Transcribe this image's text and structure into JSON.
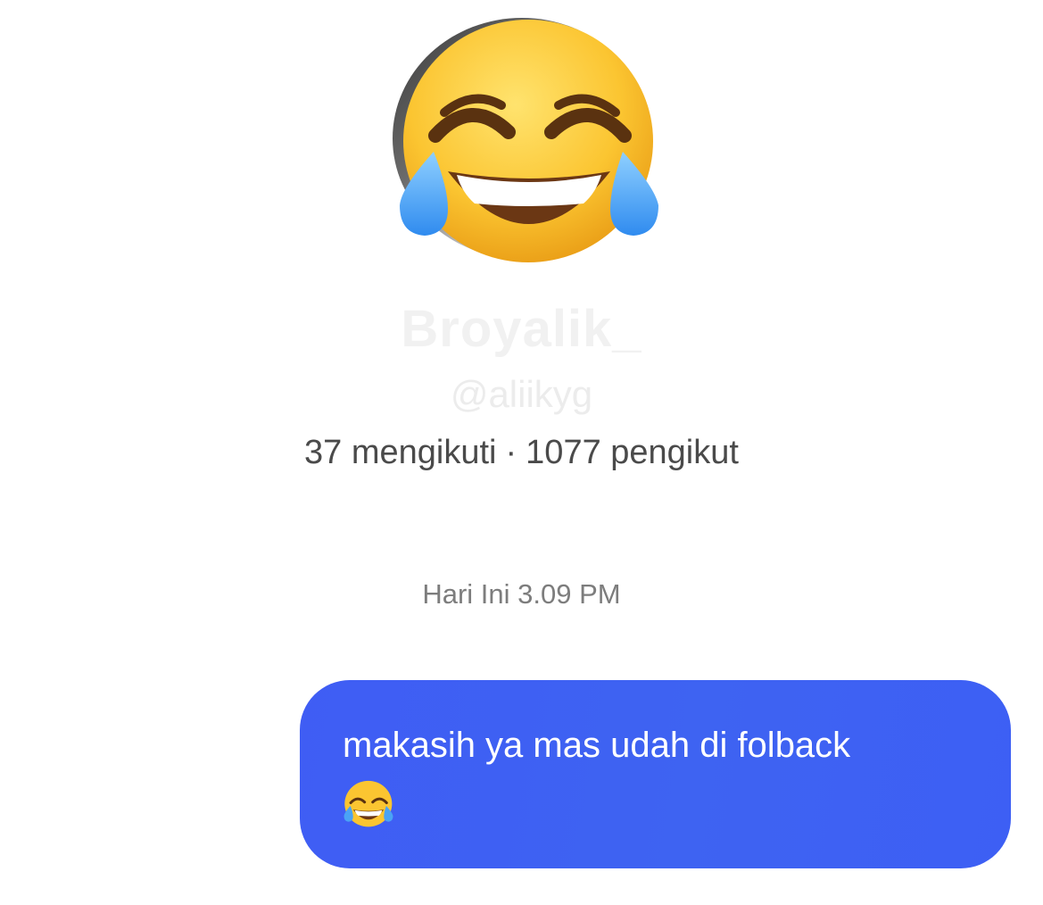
{
  "profile": {
    "display_name": "Broyalik_",
    "handle": "@aliikyg",
    "following_label": "37 mengikuti",
    "separator": "·",
    "followers_label": "1077 pengikut",
    "avatar_overlay_icon": "face-with-tears-of-joy-emoji"
  },
  "conversation": {
    "timestamp": "Hari Ini 3.09 PM",
    "messages": [
      {
        "text": "makasih ya mas udah di folback",
        "trailing_icon": "face-with-tears-of-joy-emoji",
        "bubble_color": "#3e5ff3",
        "text_color": "#ffffff"
      }
    ]
  }
}
